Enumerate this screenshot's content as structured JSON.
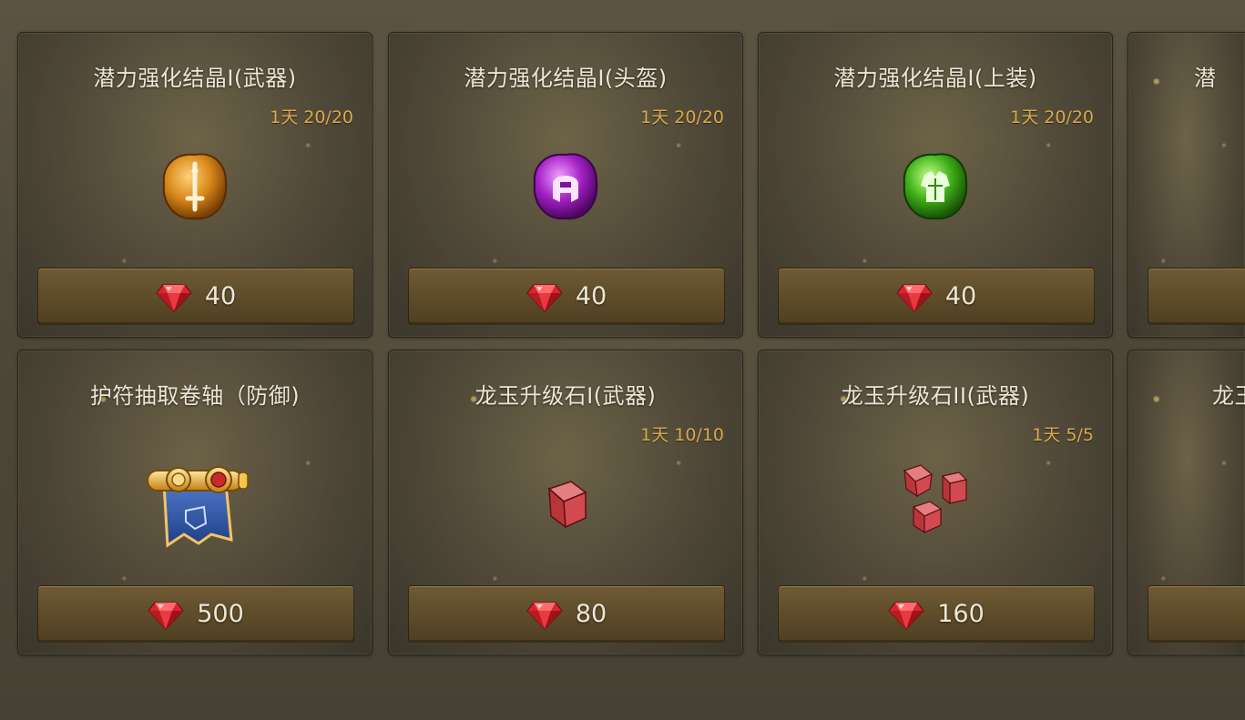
{
  "shop": {
    "currency_icon": "red-gem-icon",
    "items": [
      {
        "title": "潜力强化结晶I(武器)",
        "limit": "1天 20/20",
        "icon": "crystal-weapon-icon",
        "price": "40"
      },
      {
        "title": "潜力强化结晶I(头盔)",
        "limit": "1天 20/20",
        "icon": "crystal-helmet-icon",
        "price": "40"
      },
      {
        "title": "潜力强化结晶I(上装)",
        "limit": "1天 20/20",
        "icon": "crystal-armor-icon",
        "price": "40"
      },
      {
        "title": "潜",
        "limit": "",
        "icon": "",
        "price": ""
      },
      {
        "title": "护符抽取卷轴（防御)",
        "limit": "",
        "icon": "scroll-defense-icon",
        "price": "500"
      },
      {
        "title": "龙玉升级石I(武器)",
        "limit": "1天 10/10",
        "icon": "red-cube-icon",
        "price": "80"
      },
      {
        "title": "龙玉升级石II(武器)",
        "limit": "1天 5/5",
        "icon": "red-cubes-icon",
        "price": "160"
      },
      {
        "title": "龙玉",
        "limit": "",
        "icon": "",
        "price": ""
      }
    ],
    "colors": {
      "title_text": "#ece6d6",
      "limit_text": "#d9a94a",
      "button_fill": "#5d4b29",
      "gem_red": "#d8262f"
    }
  }
}
